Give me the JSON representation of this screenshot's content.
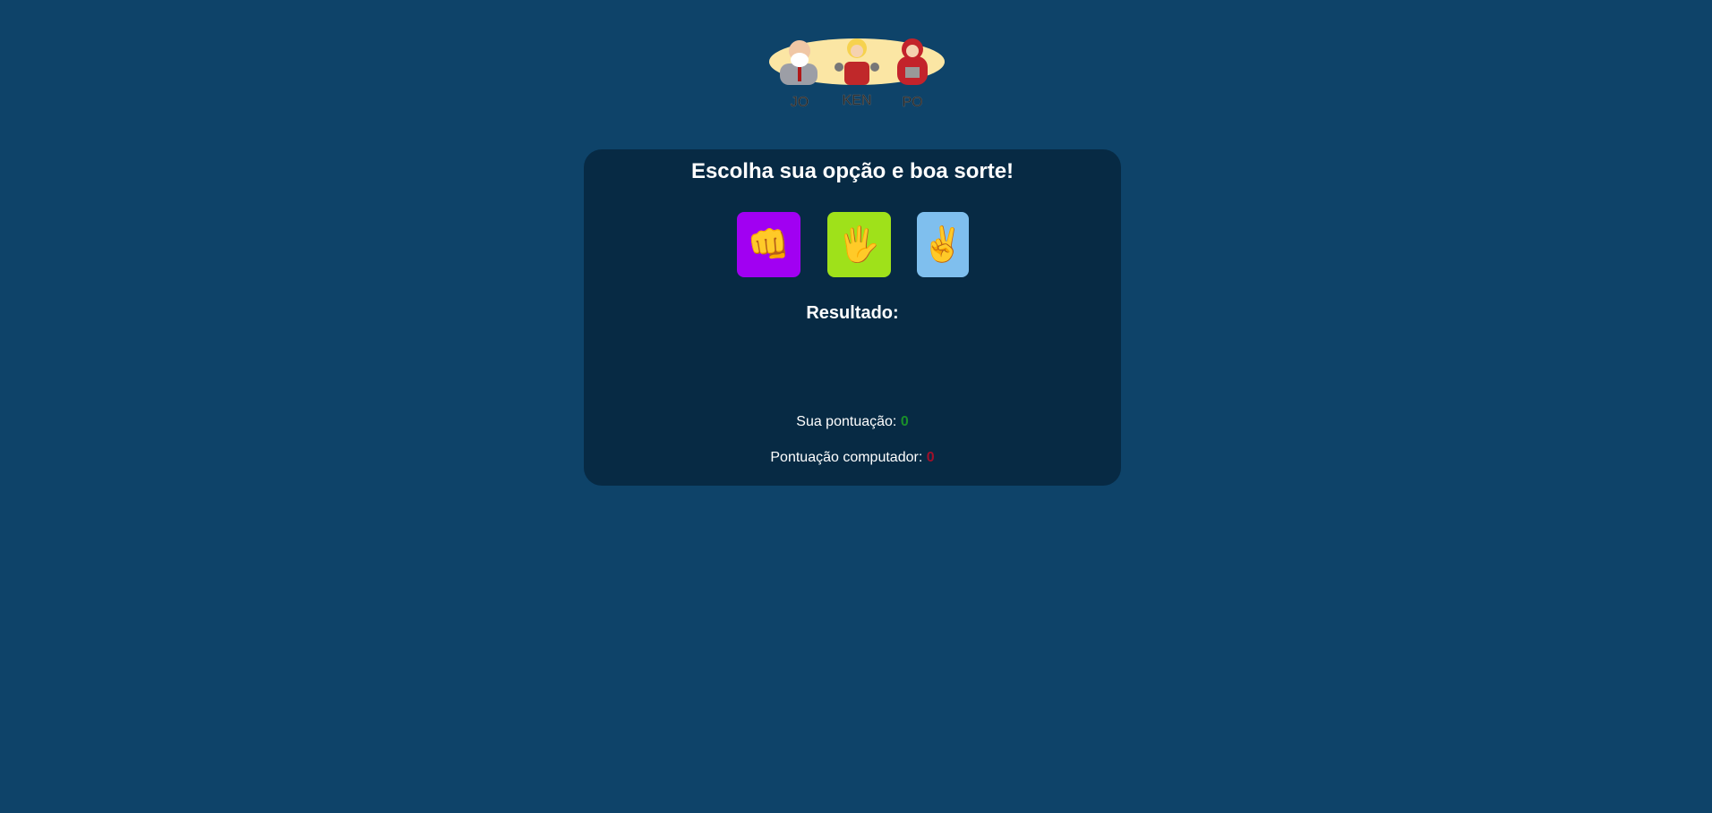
{
  "logo": {
    "text": [
      "JO",
      "KEN",
      "PO"
    ]
  },
  "title": "Escolha sua opção e boa sorte!",
  "options": [
    {
      "name": "pedra",
      "icon": "fist-icon",
      "glyph": "👊",
      "color": "#a100f2"
    },
    {
      "name": "papel",
      "icon": "raised-hand-icon",
      "glyph": "🖐",
      "color": "#9fe11a"
    },
    {
      "name": "tesoura",
      "icon": "victory-hand-icon",
      "glyph": "✌",
      "color": "#7fbfee"
    }
  ],
  "result": {
    "label": "Resultado:",
    "value": ""
  },
  "scores": {
    "player_label": "Sua pontuação:",
    "player_value": "0",
    "player_color": "#1a8f2a",
    "computer_label": "Pontuação computador:",
    "computer_value": "0",
    "computer_color": "#a0102a"
  }
}
